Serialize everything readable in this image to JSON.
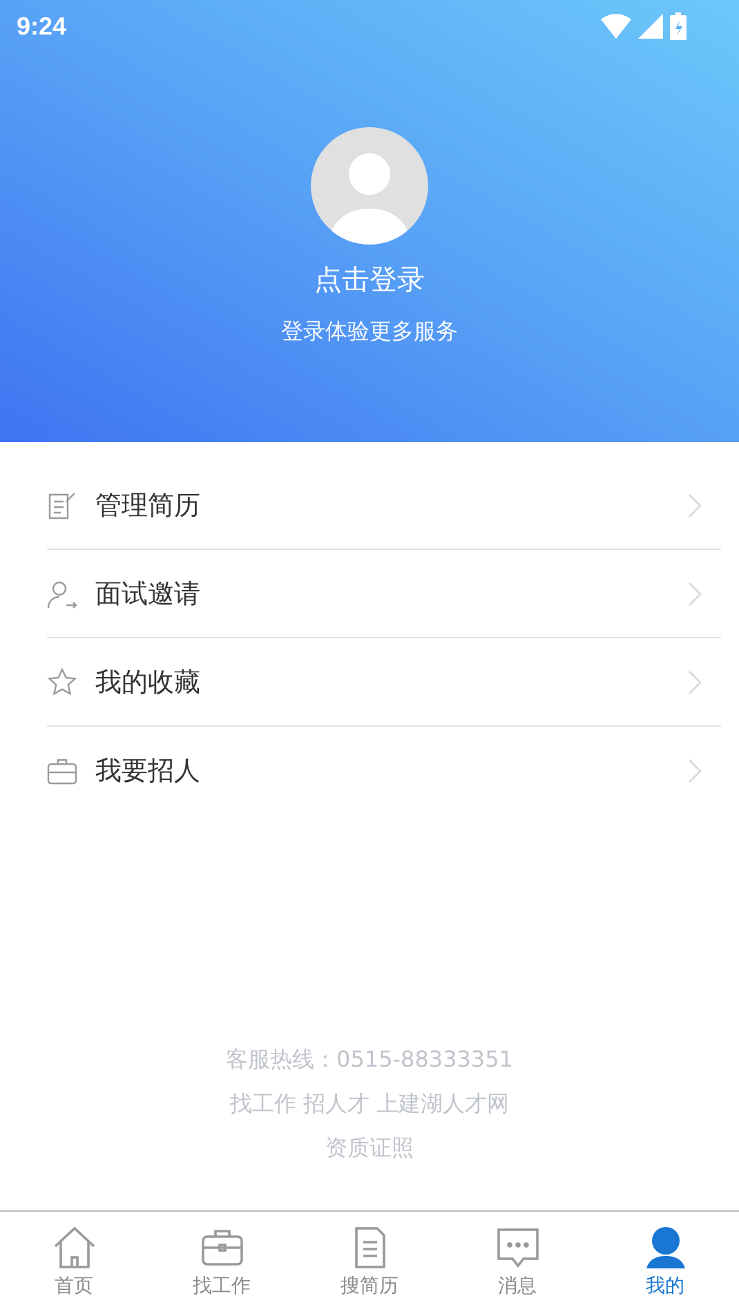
{
  "status_bar": {
    "time": "9:24"
  },
  "profile": {
    "title": "点击登录",
    "subtitle": "登录体验更多服务"
  },
  "menu": [
    {
      "kind": "resume",
      "label": "管理简历"
    },
    {
      "kind": "interview",
      "label": "面试邀请"
    },
    {
      "kind": "favorite",
      "label": "我的收藏"
    },
    {
      "kind": "recruit",
      "label": "我要招人"
    }
  ],
  "footer": [
    "客服热线：0515-88333351",
    "找工作 招人才 上建湖人才网",
    "资质证照"
  ],
  "tabs": [
    {
      "kind": "home",
      "label": "首页",
      "selected": false
    },
    {
      "kind": "jobs",
      "label": "找工作",
      "selected": false
    },
    {
      "kind": "resumes",
      "label": "搜简历",
      "selected": false
    },
    {
      "kind": "messages",
      "label": "消息",
      "selected": false
    },
    {
      "kind": "me",
      "label": "我的",
      "selected": true
    }
  ]
}
